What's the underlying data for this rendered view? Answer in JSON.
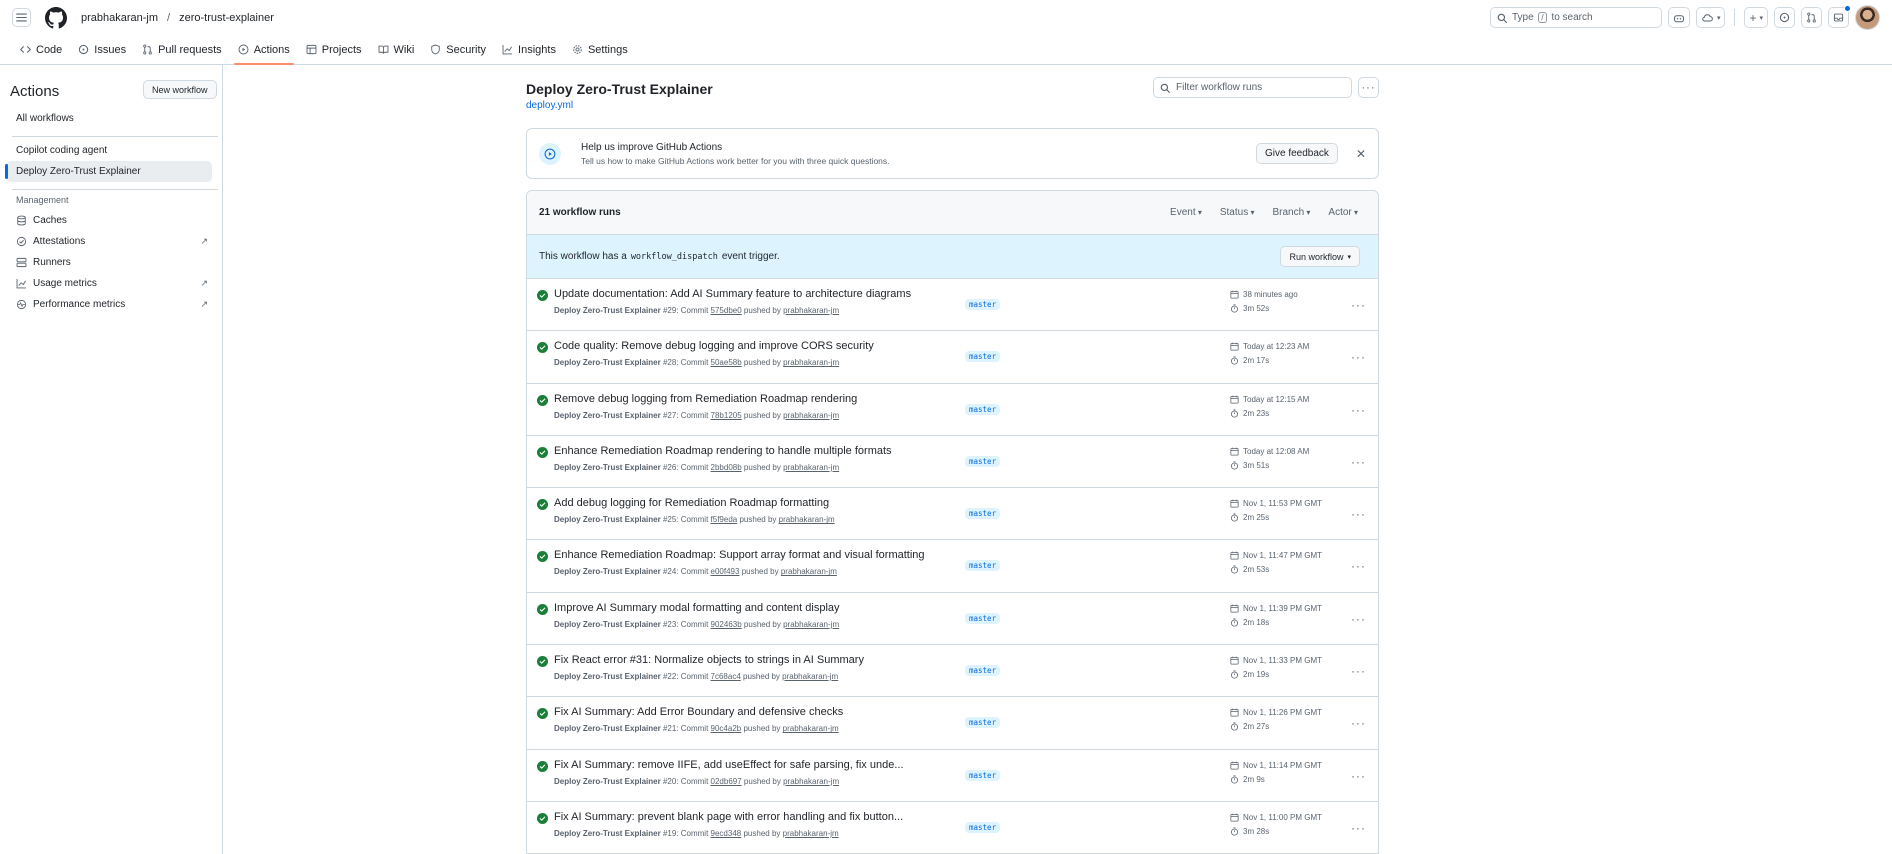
{
  "header": {
    "owner": "prabhakaran-jm",
    "repo": "zero-trust-explainer",
    "search_placeholder": "Type / to search",
    "search_before": "Type",
    "search_key": "/",
    "search_after": "to search"
  },
  "tabs": [
    {
      "label": "Code",
      "icon": "code-icon"
    },
    {
      "label": "Issues",
      "icon": "issue-icon"
    },
    {
      "label": "Pull requests",
      "icon": "pull-request-icon"
    },
    {
      "label": "Actions",
      "icon": "play-icon",
      "active": true
    },
    {
      "label": "Projects",
      "icon": "table-icon"
    },
    {
      "label": "Wiki",
      "icon": "book-icon"
    },
    {
      "label": "Security",
      "icon": "shield-icon"
    },
    {
      "label": "Insights",
      "icon": "graph-icon"
    },
    {
      "label": "Settings",
      "icon": "gear-icon"
    }
  ],
  "sidebar": {
    "title": "Actions",
    "new_workflow": "New workflow",
    "all_workflows": "All workflows",
    "workflows": [
      "Copilot coding agent",
      "Deploy Zero-Trust Explainer"
    ],
    "management_heading": "Management",
    "management": [
      {
        "label": "Caches",
        "icon": "database-icon",
        "external": false
      },
      {
        "label": "Attestations",
        "icon": "verified-icon",
        "external": true
      },
      {
        "label": "Runners",
        "icon": "server-icon",
        "external": false
      },
      {
        "label": "Usage metrics",
        "icon": "graph-icon",
        "external": true
      },
      {
        "label": "Performance metrics",
        "icon": "pulse-icon",
        "external": true
      }
    ]
  },
  "main": {
    "title": "Deploy Zero-Trust Explainer",
    "file": "deploy.yml",
    "filter_placeholder": "Filter workflow runs"
  },
  "feedback": {
    "title": "Help us improve GitHub Actions",
    "subtitle": "Tell us how to make GitHub Actions work better for you with three quick questions.",
    "button": "Give feedback"
  },
  "runs": {
    "count": "21 workflow runs",
    "filters": [
      "Event",
      "Status",
      "Branch",
      "Actor"
    ],
    "dispatch_pre": "This workflow has a",
    "dispatch_code": "workflow_dispatch",
    "dispatch_post": "event trigger.",
    "run_button": "Run workflow",
    "items": [
      {
        "title": "Update documentation: Add AI Summary feature to architecture diagrams",
        "workflow": "Deploy Zero-Trust Explainer",
        "num": "#29: Commit",
        "sha": "575dbe0",
        "pushed": "pushed by",
        "user": "prabhakaran-jm",
        "branch": "master",
        "when": "38 minutes ago",
        "duration": "3m 52s"
      },
      {
        "title": "Code quality: Remove debug logging and improve CORS security",
        "workflow": "Deploy Zero-Trust Explainer",
        "num": "#28: Commit",
        "sha": "50ae58b",
        "pushed": "pushed by",
        "user": "prabhakaran-jm",
        "branch": "master",
        "when": "Today at 12:23 AM",
        "duration": "2m 17s"
      },
      {
        "title": "Remove debug logging from Remediation Roadmap rendering",
        "workflow": "Deploy Zero-Trust Explainer",
        "num": "#27: Commit",
        "sha": "78b1205",
        "pushed": "pushed by",
        "user": "prabhakaran-jm",
        "branch": "master",
        "when": "Today at 12:15 AM",
        "duration": "2m 23s"
      },
      {
        "title": "Enhance Remediation Roadmap rendering to handle multiple formats",
        "workflow": "Deploy Zero-Trust Explainer",
        "num": "#26: Commit",
        "sha": "2bbd08b",
        "pushed": "pushed by",
        "user": "prabhakaran-jm",
        "branch": "master",
        "when": "Today at 12:08 AM",
        "duration": "3m 51s"
      },
      {
        "title": "Add debug logging for Remediation Roadmap formatting",
        "workflow": "Deploy Zero-Trust Explainer",
        "num": "#25: Commit",
        "sha": "f5f9eda",
        "pushed": "pushed by",
        "user": "prabhakaran-jm",
        "branch": "master",
        "when": "Nov 1, 11:53 PM GMT",
        "duration": "2m 25s"
      },
      {
        "title": "Enhance Remediation Roadmap: Support array format and visual formatting",
        "workflow": "Deploy Zero-Trust Explainer",
        "num": "#24: Commit",
        "sha": "e00f493",
        "pushed": "pushed by",
        "user": "prabhakaran-jm",
        "branch": "master",
        "when": "Nov 1, 11:47 PM GMT",
        "duration": "2m 53s"
      },
      {
        "title": "Improve AI Summary modal formatting and content display",
        "workflow": "Deploy Zero-Trust Explainer",
        "num": "#23: Commit",
        "sha": "902463b",
        "pushed": "pushed by",
        "user": "prabhakaran-jm",
        "branch": "master",
        "when": "Nov 1, 11:39 PM GMT",
        "duration": "2m 18s"
      },
      {
        "title": "Fix React error #31: Normalize objects to strings in AI Summary",
        "workflow": "Deploy Zero-Trust Explainer",
        "num": "#22: Commit",
        "sha": "7c68ac4",
        "pushed": "pushed by",
        "user": "prabhakaran-jm",
        "branch": "master",
        "when": "Nov 1, 11:33 PM GMT",
        "duration": "2m 19s"
      },
      {
        "title": "Fix AI Summary: Add Error Boundary and defensive checks",
        "workflow": "Deploy Zero-Trust Explainer",
        "num": "#21: Commit",
        "sha": "90c4a2b",
        "pushed": "pushed by",
        "user": "prabhakaran-jm",
        "branch": "master",
        "when": "Nov 1, 11:26 PM GMT",
        "duration": "2m 27s"
      },
      {
        "title": "Fix AI Summary: remove IIFE, add useEffect for safe parsing, fix unde...",
        "workflow": "Deploy Zero-Trust Explainer",
        "num": "#20: Commit",
        "sha": "02db697",
        "pushed": "pushed by",
        "user": "prabhakaran-jm",
        "branch": "master",
        "when": "Nov 1, 11:14 PM GMT",
        "duration": "2m 9s"
      },
      {
        "title": "Fix AI Summary: prevent blank page with error handling and fix button...",
        "workflow": "Deploy Zero-Trust Explainer",
        "num": "#19: Commit",
        "sha": "9ecd348",
        "pushed": "pushed by",
        "user": "prabhakaran-jm",
        "branch": "master",
        "when": "Nov 1, 11:00 PM GMT",
        "duration": "3m 28s"
      }
    ]
  },
  "colors": {
    "accent": "#0969da",
    "success": "#1a7f37",
    "tab_underline": "#fd8c73",
    "banner": "#ddf4ff"
  }
}
